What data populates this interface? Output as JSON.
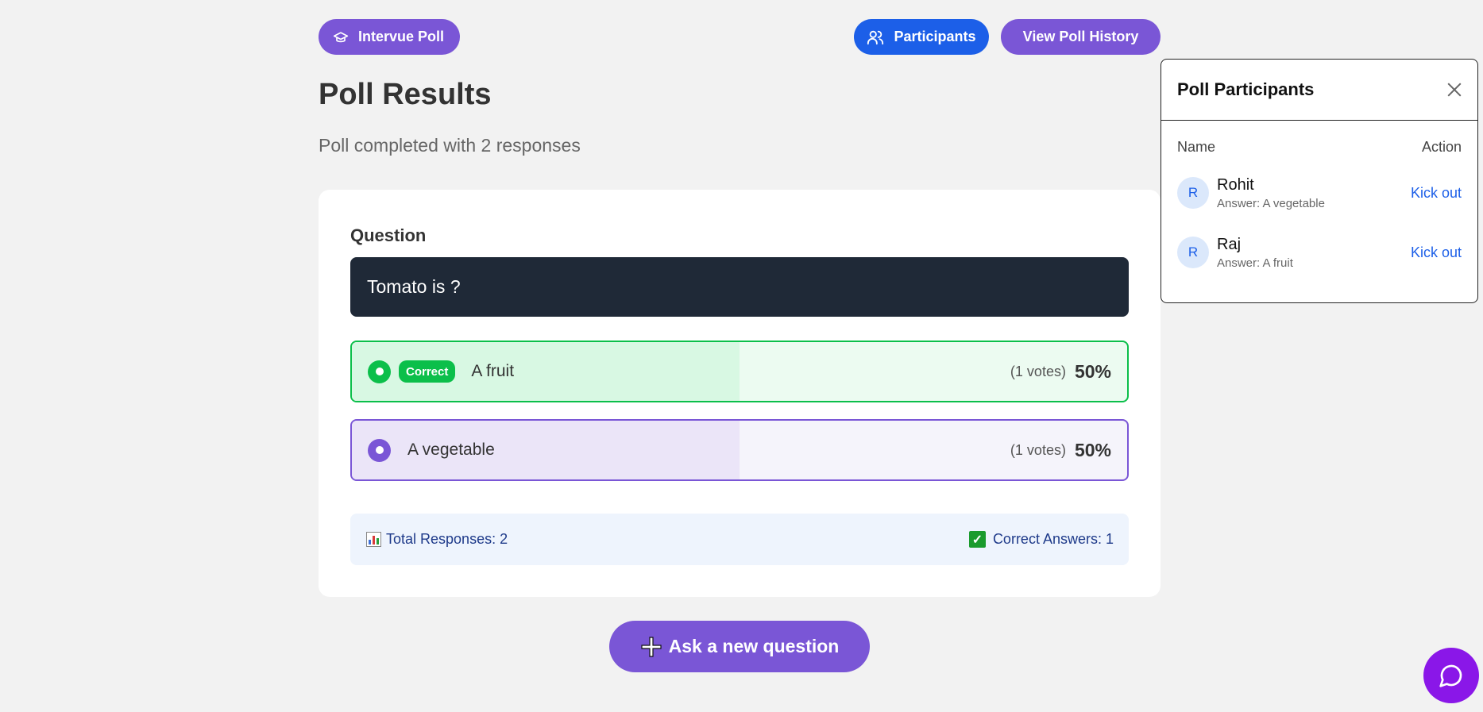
{
  "header": {
    "brand_label": "Intervue Poll",
    "participants_label": "Participants",
    "history_label": "View Poll History"
  },
  "page": {
    "title": "Poll Results",
    "subtitle": "Poll completed with 2 responses"
  },
  "question": {
    "label": "Question",
    "text": "Tomato is ?"
  },
  "options": [
    {
      "text": "A fruit",
      "votes": "(1 votes)",
      "percent": "50%",
      "fraction": 0.5,
      "correct": true,
      "badge": "Correct"
    },
    {
      "text": "A vegetable",
      "votes": "(1 votes)",
      "percent": "50%",
      "fraction": 0.5,
      "correct": false
    }
  ],
  "stats": {
    "total": "Total Responses: 2",
    "correct": "Correct Answers: 1"
  },
  "ask_button": "Ask a new question",
  "participants_panel": {
    "title": "Poll Participants",
    "col_name": "Name",
    "col_action": "Action",
    "rows": [
      {
        "initial": "R",
        "name": "Rohit",
        "answer": "Answer: A vegetable",
        "action": "Kick out"
      },
      {
        "initial": "R",
        "name": "Raj",
        "answer": "Answer: A fruit",
        "action": "Kick out"
      }
    ]
  },
  "colors": {
    "primary": "#7a56d6",
    "blue": "#1c5fe8",
    "correct": "#0bbf4a",
    "question_bg": "#1f2937",
    "chat": "#8a17e8"
  }
}
